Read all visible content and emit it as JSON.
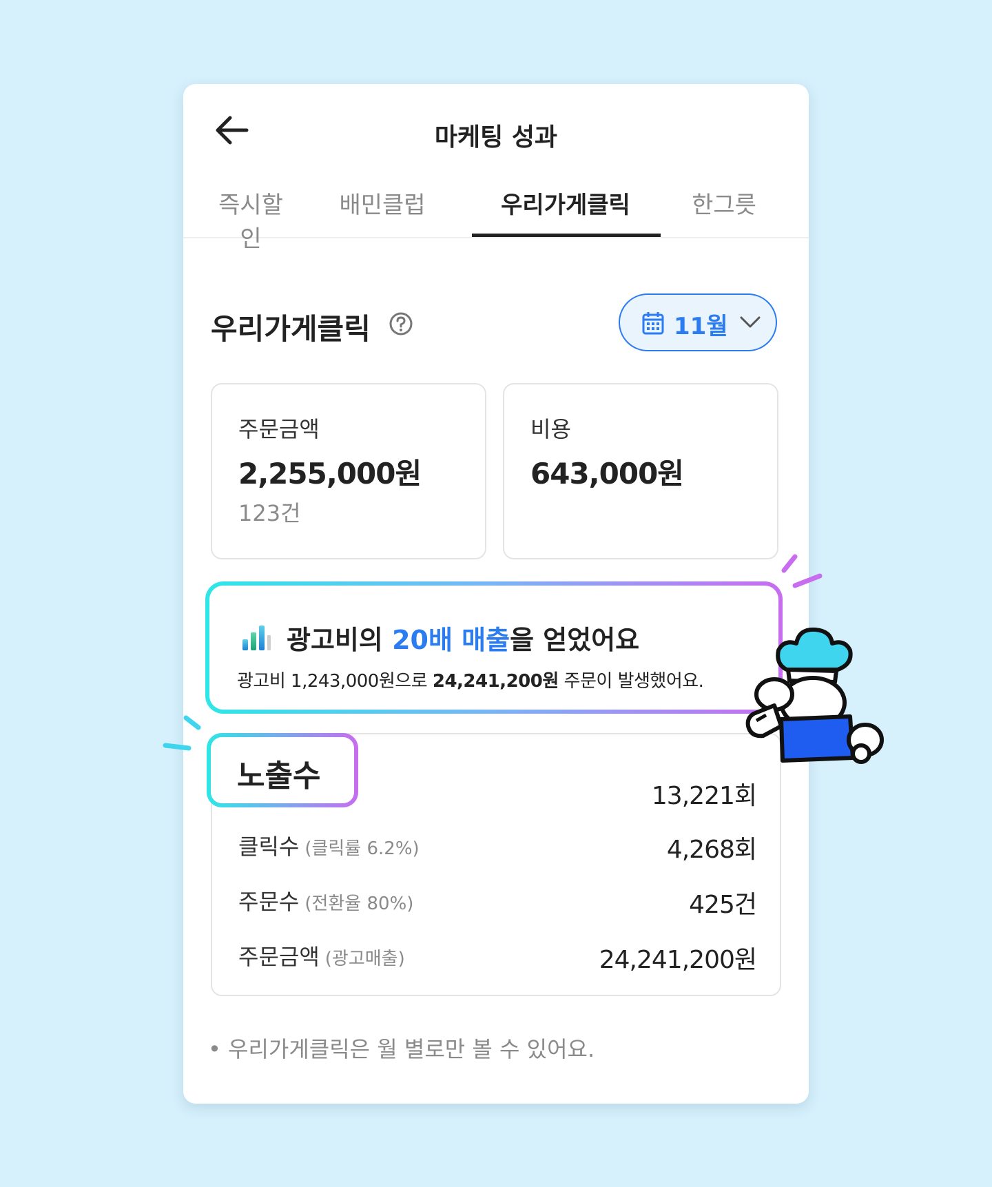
{
  "header": {
    "title": "마케팅 성과",
    "back_icon": "arrow-left-icon"
  },
  "tabs": [
    {
      "label": "즉시할인",
      "active": false
    },
    {
      "label": "배민클럽",
      "active": false
    },
    {
      "label": "우리가게클릭",
      "active": true
    },
    {
      "label": "한그릇",
      "active": false
    }
  ],
  "section": {
    "title": "우리가게클릭",
    "help_icon": "question-circle-icon"
  },
  "month_selector": {
    "label": "11월",
    "icon": "calendar-icon",
    "chevron": "chevron-down-icon"
  },
  "stats": {
    "order_amount": {
      "label": "주문금액",
      "value": "2,255,000원",
      "sub": "123건"
    },
    "cost": {
      "label": "비용",
      "value": "643,000원"
    }
  },
  "highlight": {
    "icon": "bar-chart-icon",
    "title_pre": "광고비의 ",
    "title_accent": "20배 매출",
    "title_post": "을 얻었어요",
    "sub_pre": "광고비 1,243,000원으로 ",
    "sub_bold": "24,241,200원",
    "sub_post": " 주문이 발생했어요."
  },
  "metrics": {
    "impressions": {
      "label": "노출수",
      "value": "13,221회"
    },
    "clicks": {
      "label": "클릭수",
      "note": "(클릭률 6.2%)",
      "value": "4,268회"
    },
    "orders": {
      "label": "주문수",
      "note": "(전환율 80%)",
      "value": "425건"
    },
    "ad_sales": {
      "label": "주문금액",
      "note": "(광고매출)",
      "value": "24,241,200원"
    }
  },
  "footnote": "• 우리가게클릭은 월 별로만 볼 수 있어요.",
  "colors": {
    "accent": "#2a7cf0",
    "background": "#d6f0fc",
    "gradient_start": "#2ee6e6",
    "gradient_end": "#c86cf0",
    "mascot_body": "#1f5cf0",
    "mascot_hat": "#3fd5ee"
  }
}
